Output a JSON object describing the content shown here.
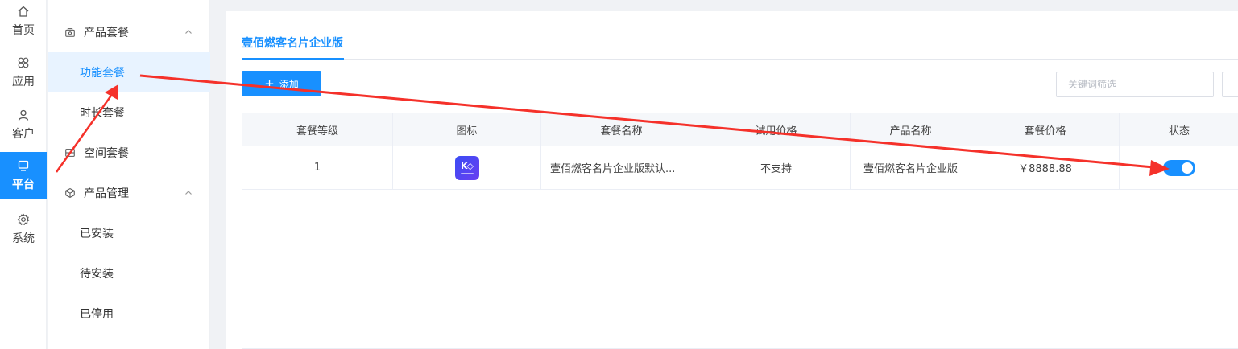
{
  "rail": {
    "items": [
      {
        "label": "首页",
        "icon": "home-icon"
      },
      {
        "label": "应用",
        "icon": "apps-icon"
      },
      {
        "label": "客户",
        "icon": "user-icon"
      },
      {
        "label": "平台",
        "icon": "monitor-icon",
        "active": true
      },
      {
        "label": "系统",
        "icon": "gear-icon"
      }
    ]
  },
  "submenu": {
    "group1": {
      "label": "产品套餐",
      "icon": "package-icon"
    },
    "items1": [
      {
        "label": "功能套餐",
        "active": true
      },
      {
        "label": "时长套餐"
      }
    ],
    "space": {
      "label": "空间套餐",
      "icon": "storage-icon"
    },
    "group2": {
      "label": "产品管理",
      "icon": "cube-icon"
    },
    "items2": [
      {
        "label": "已安装"
      },
      {
        "label": "待安装"
      },
      {
        "label": "已停用"
      }
    ]
  },
  "main": {
    "tab": "壹佰燃客名片企业版",
    "add_button": "添加",
    "search_placeholder": "关键词筛选",
    "table": {
      "headers": [
        "套餐等级",
        "图标",
        "套餐名称",
        "试用价格",
        "产品名称",
        "套餐价格",
        "状态"
      ],
      "rows": [
        {
          "level": "1",
          "icon": "app-logo-icon",
          "name": "壹佰燃客名片企业版默认...",
          "trial_price": "不支持",
          "product_name": "壹佰燃客名片企业版",
          "price": "￥8888.88",
          "status": true
        }
      ]
    }
  },
  "colors": {
    "accent": "#1890ff",
    "annotation": "#f5312a"
  }
}
